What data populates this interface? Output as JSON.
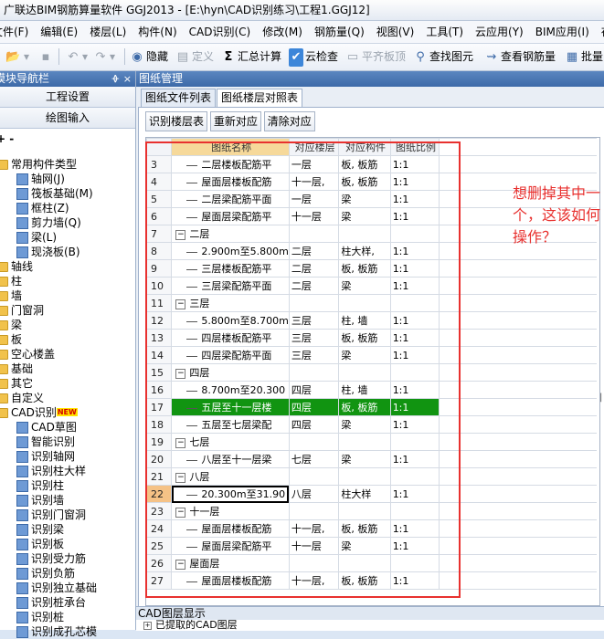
{
  "window": {
    "title": "广联达BIM钢筋算量软件 GGJ2013 - [E:\\hyn\\CAD识别练习\\工程1.GGJ12]"
  },
  "menu": [
    "文件(F)",
    "编辑(E)",
    "楼层(L)",
    "构件(N)",
    "CAD识别(C)",
    "修改(M)",
    "钢筋量(Q)",
    "视图(V)",
    "工具(T)",
    "云应用(Y)",
    "BIM应用(I)",
    "在线服务(S)"
  ],
  "toolbar": {
    "hide": "隐藏",
    "define": "定义",
    "sum": "汇总计算",
    "cloud_check": "云检查",
    "flush_slab": "平齐板顶",
    "find_element": "查找图元",
    "view_rebar": "查看钢筋量",
    "batch": "批量"
  },
  "left_panel": {
    "title": "模块导航栏",
    "pin": "ᚖ",
    "close": "×",
    "buttons": [
      "工程设置",
      "绘图输入"
    ],
    "tree_tools": "+ -",
    "tree": [
      {
        "label": "常用构件类型",
        "level": 0,
        "icon": "folder"
      },
      {
        "label": "轴网(J)",
        "level": 1,
        "icon": "grid-icon"
      },
      {
        "label": "筏板基础(M)",
        "level": 1,
        "icon": "raft-icon"
      },
      {
        "label": "框柱(Z)",
        "level": 1,
        "icon": "column-icon"
      },
      {
        "label": "剪力墙(Q)",
        "level": 1,
        "icon": "wall-icon"
      },
      {
        "label": "梁(L)",
        "level": 1,
        "icon": "beam-icon"
      },
      {
        "label": "现浇板(B)",
        "level": 1,
        "icon": "slab-icon"
      },
      {
        "label": "轴线",
        "level": 0,
        "icon": "folder"
      },
      {
        "label": "柱",
        "level": 0,
        "icon": "folder"
      },
      {
        "label": "墙",
        "level": 0,
        "icon": "folder"
      },
      {
        "label": "门窗洞",
        "level": 0,
        "icon": "folder"
      },
      {
        "label": "梁",
        "level": 0,
        "icon": "folder"
      },
      {
        "label": "板",
        "level": 0,
        "icon": "folder"
      },
      {
        "label": "空心楼盖",
        "level": 0,
        "icon": "folder"
      },
      {
        "label": "基础",
        "level": 0,
        "icon": "folder"
      },
      {
        "label": "其它",
        "level": 0,
        "icon": "folder"
      },
      {
        "label": "自定义",
        "level": 0,
        "icon": "folder"
      },
      {
        "label": "CAD识别",
        "level": 0,
        "icon": "folder",
        "badge": "NEW"
      },
      {
        "label": "CAD草图",
        "level": 1,
        "icon": "cad-icon"
      },
      {
        "label": "智能识别",
        "level": 1,
        "icon": "smart-icon"
      },
      {
        "label": "识别轴网",
        "level": 1,
        "icon": "grid-icon"
      },
      {
        "label": "识别柱大样",
        "level": 1,
        "icon": "column-icon"
      },
      {
        "label": "识别柱",
        "level": 1,
        "icon": "column-icon"
      },
      {
        "label": "识别墙",
        "level": 1,
        "icon": "wall-icon"
      },
      {
        "label": "识别门窗洞",
        "level": 1,
        "icon": "door-icon"
      },
      {
        "label": "识别梁",
        "level": 1,
        "icon": "beam-icon"
      },
      {
        "label": "识别板",
        "level": 1,
        "icon": "slab-icon"
      },
      {
        "label": "识别受力筋",
        "level": 1,
        "icon": "rebar-icon"
      },
      {
        "label": "识别负筋",
        "level": 1,
        "icon": "rebar-icon"
      },
      {
        "label": "识别独立基础",
        "level": 1,
        "icon": "foundation-icon"
      },
      {
        "label": "识别桩承台",
        "level": 1,
        "icon": "cap-icon"
      },
      {
        "label": "识别桩",
        "level": 1,
        "icon": "pile-icon"
      },
      {
        "label": "识别成孔芯模",
        "level": 1,
        "icon": "core-icon"
      }
    ]
  },
  "right_panel": {
    "title": "图纸管理",
    "tabs": [
      "图纸文件列表",
      "图纸楼层对照表"
    ],
    "buttons": [
      "识别楼层表",
      "重新对应",
      "清除对应"
    ],
    "grid": {
      "headers": [
        "",
        "图纸名称",
        "对应楼层",
        "对应构件",
        "图纸比例"
      ],
      "rows": [
        {
          "n": "3",
          "type": "child",
          "name": "二层楼板配筋平",
          "floor": "一层",
          "comp": "板, 板筋",
          "scale": "1:1"
        },
        {
          "n": "4",
          "type": "child",
          "name": "屋面层楼板配筋",
          "floor": "十一层,",
          "comp": "板, 板筋",
          "scale": "1:1"
        },
        {
          "n": "5",
          "type": "child",
          "name": "二层梁配筋平面",
          "floor": "一层",
          "comp": "梁",
          "scale": "1:1"
        },
        {
          "n": "6",
          "type": "child",
          "name": "屋面层梁配筋平",
          "floor": "十一层",
          "comp": "梁",
          "scale": "1:1"
        },
        {
          "n": "7",
          "type": "group",
          "name": "二层",
          "floor": "",
          "comp": "",
          "scale": ""
        },
        {
          "n": "8",
          "type": "child",
          "name": "2.900m至5.800m",
          "floor": "二层",
          "comp": "柱大样,",
          "scale": "1:1"
        },
        {
          "n": "9",
          "type": "child",
          "name": "三层楼板配筋平",
          "floor": "二层",
          "comp": "板, 板筋",
          "scale": "1:1"
        },
        {
          "n": "10",
          "type": "child",
          "name": "三层梁配筋平面",
          "floor": "二层",
          "comp": "梁",
          "scale": "1:1"
        },
        {
          "n": "11",
          "type": "group",
          "name": "三层",
          "floor": "",
          "comp": "",
          "scale": ""
        },
        {
          "n": "12",
          "type": "child",
          "name": "5.800m至8.700m",
          "floor": "三层",
          "comp": "柱, 墙",
          "scale": "1:1"
        },
        {
          "n": "13",
          "type": "child",
          "name": "四层楼板配筋平",
          "floor": "三层",
          "comp": "板, 板筋",
          "scale": "1:1"
        },
        {
          "n": "14",
          "type": "child",
          "name": "四层梁配筋平面",
          "floor": "三层",
          "comp": "梁",
          "scale": "1:1"
        },
        {
          "n": "15",
          "type": "group",
          "name": "四层",
          "floor": "",
          "comp": "",
          "scale": ""
        },
        {
          "n": "16",
          "type": "child",
          "name": "8.700m至20.300",
          "floor": "四层",
          "comp": "柱, 墙",
          "scale": "1:1"
        },
        {
          "n": "17",
          "type": "child",
          "name": "五层至十一层楼",
          "floor": "四层",
          "comp": "板, 板筋",
          "scale": "1:1",
          "highlight": true
        },
        {
          "n": "18",
          "type": "child",
          "name": "五层至七层梁配",
          "floor": "四层",
          "comp": "梁",
          "scale": "1:1"
        },
        {
          "n": "19",
          "type": "group",
          "name": "七层",
          "floor": "",
          "comp": "",
          "scale": ""
        },
        {
          "n": "20",
          "type": "child",
          "name": "八层至十一层梁",
          "floor": "七层",
          "comp": "梁",
          "scale": "1:1"
        },
        {
          "n": "21",
          "type": "group",
          "name": "八层",
          "floor": "",
          "comp": "",
          "scale": ""
        },
        {
          "n": "22",
          "type": "child",
          "name": "20.300m至31.90",
          "floor": "八层",
          "comp": "柱大样",
          "scale": "1:1",
          "current": true
        },
        {
          "n": "23",
          "type": "group",
          "name": "十一层",
          "floor": "",
          "comp": "",
          "scale": ""
        },
        {
          "n": "24",
          "type": "child",
          "name": "屋面层楼板配筋",
          "floor": "十一层,",
          "comp": "板, 板筋",
          "scale": "1:1"
        },
        {
          "n": "25",
          "type": "child",
          "name": "屋面层梁配筋平",
          "floor": "十一层",
          "comp": "梁",
          "scale": "1:1"
        },
        {
          "n": "26",
          "type": "group",
          "name": "屋面层",
          "floor": "",
          "comp": "",
          "scale": ""
        },
        {
          "n": "27",
          "type": "child",
          "name": "屋面层楼板配筋",
          "floor": "十一层,",
          "comp": "板, 板筋",
          "scale": "1:1"
        }
      ]
    }
  },
  "annotation": "想删掉其中一个，这该如何操作？",
  "bottom_panel": {
    "title": "CAD图层显示",
    "row": "已提取的CAD图层"
  },
  "colors": {
    "highlight": "#119411",
    "annotation": "#e8312f",
    "header_blue": "#3d6aa8"
  }
}
